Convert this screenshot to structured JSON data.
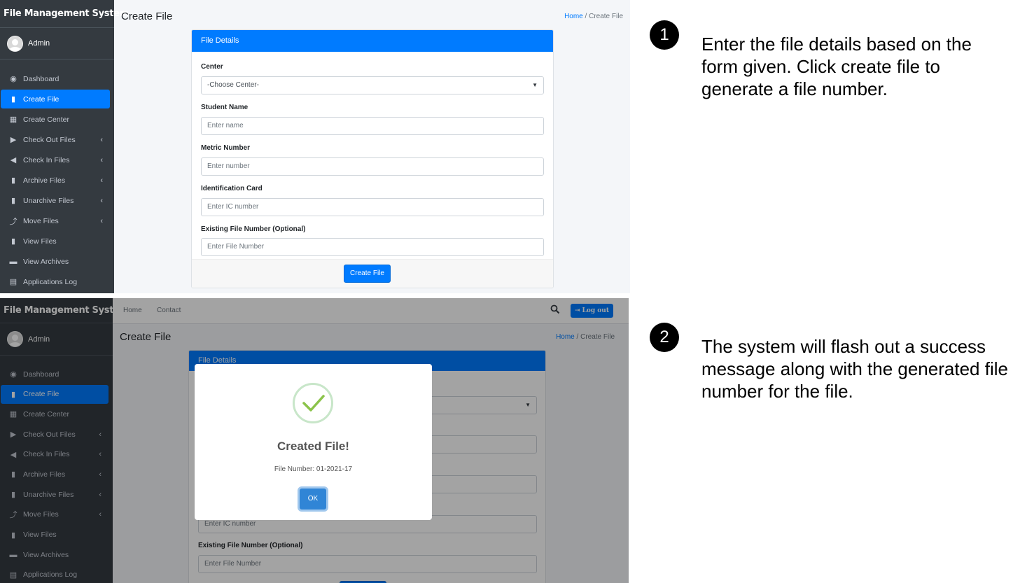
{
  "sidebar": {
    "brand": "File Management System",
    "user": "Admin",
    "items": [
      {
        "label": "Dashboard",
        "icon": "tachometer-icon"
      },
      {
        "label": "Create File",
        "icon": "file-icon",
        "active": true
      },
      {
        "label": "Create Center",
        "icon": "building-icon"
      },
      {
        "label": "Check Out Files",
        "icon": "file-export-icon",
        "chevron": true
      },
      {
        "label": "Check In Files",
        "icon": "file-import-icon",
        "chevron": true
      },
      {
        "label": "Archive Files",
        "icon": "file-archive-icon",
        "chevron": true
      },
      {
        "label": "Unarchive Files",
        "icon": "file-archive-icon",
        "chevron": true
      },
      {
        "label": "Move Files",
        "icon": "dolly-icon",
        "chevron": true
      },
      {
        "label": "View Files",
        "icon": "file-alt-icon"
      },
      {
        "label": "View Archives",
        "icon": "archive-icon"
      },
      {
        "label": "Applications Log",
        "icon": "clipboard-icon"
      }
    ]
  },
  "topbar": {
    "home": "Home",
    "contact": "Contact",
    "logout": "Log out"
  },
  "page": {
    "title": "Create File",
    "breadcrumb_home": "Home",
    "breadcrumb_sep": "/",
    "breadcrumb_current": "Create File"
  },
  "form": {
    "header": "File Details",
    "center_label": "Center",
    "center_value": "-Choose Center-",
    "student_label": "Student Name",
    "student_placeholder": "Enter name",
    "metric_label": "Metric Number",
    "metric_placeholder": "Enter number",
    "ic_label": "Identification Card",
    "ic_placeholder": "Enter IC number",
    "existing_label": "Existing File Number (Optional)",
    "existing_placeholder": "Enter File Number",
    "submit": "Create File"
  },
  "modal": {
    "title": "Created File!",
    "text": "File Number: 01-2021-17",
    "ok": "OK"
  },
  "steps": [
    {
      "num": "1",
      "text": "Enter the file details based on the form given. Click create file to generate a file number."
    },
    {
      "num": "2",
      "text": "The system will flash out a success message along with the generated file number for the file."
    }
  ],
  "colors": {
    "primary": "#007bff",
    "sidebar": "#343a40",
    "success": "#8bc34a",
    "confirm": "#3085d6"
  }
}
